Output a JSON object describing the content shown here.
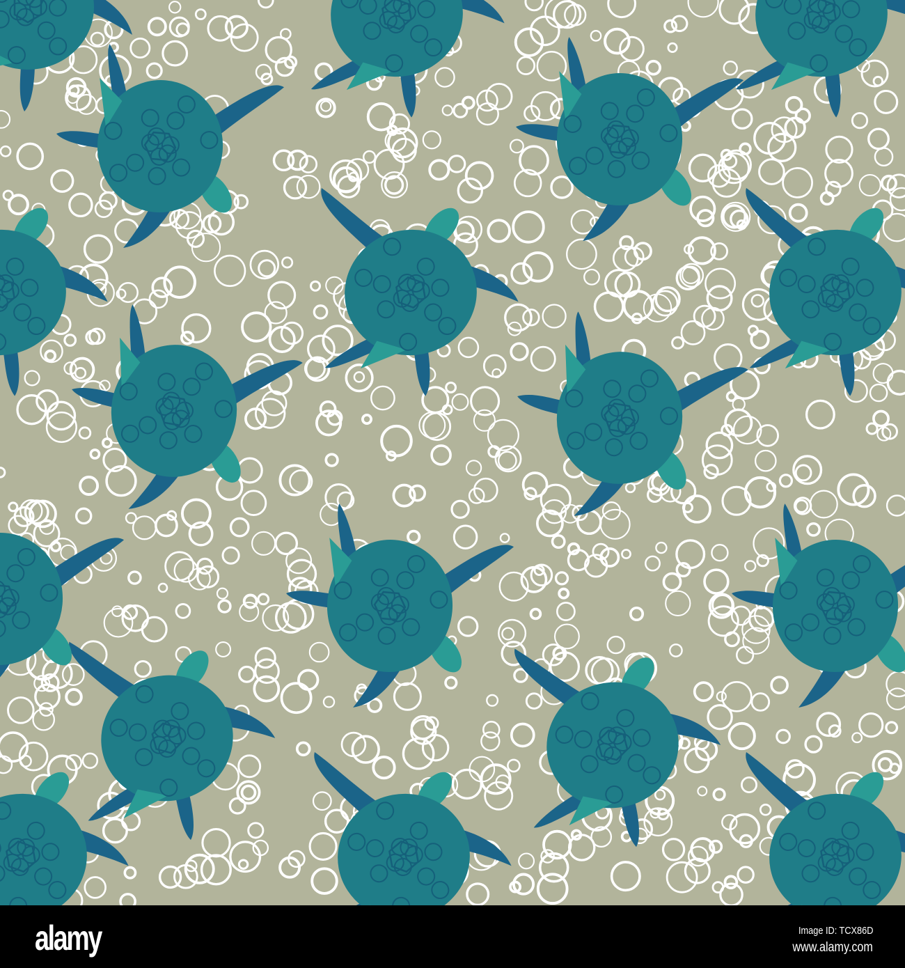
{
  "colors": {
    "background": "#b2b49b",
    "bubble": "#ffffff",
    "shell": "#1f7d88",
    "shell_pattern": "#15607a",
    "flipper": "#1b6489",
    "head": "#2a9c95"
  },
  "watermark": "alamy",
  "footer": {
    "logo": "alamy",
    "image_id": "Image ID: TCX86D",
    "website": "www.alamy.com"
  }
}
